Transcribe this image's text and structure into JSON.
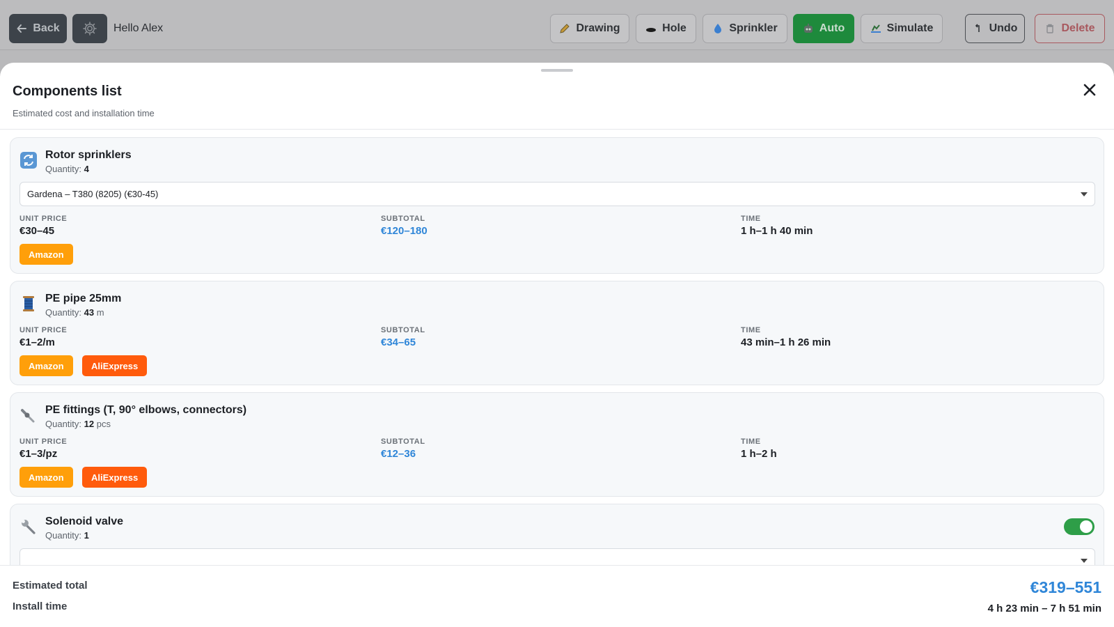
{
  "toolbar": {
    "back_label": "Back",
    "greeting": "Hello Alex",
    "tools": [
      {
        "label": "Drawing",
        "icon": "pencil-icon"
      },
      {
        "label": "Hole",
        "icon": "hole-icon"
      },
      {
        "label": "Sprinkler",
        "icon": "droplet-icon"
      },
      {
        "label": "Auto",
        "icon": "robot-icon",
        "active": true
      },
      {
        "label": "Simulate",
        "icon": "simulate-icon"
      }
    ],
    "undo_label": "Undo",
    "delete_label": "Delete"
  },
  "sheet": {
    "title": "Components list",
    "subtitle": "Estimated cost and installation time"
  },
  "labels": {
    "unit_price": "UNIT PRICE",
    "subtotal": "SUBTOTAL",
    "time": "TIME",
    "quantity": "Quantity:"
  },
  "components": [
    {
      "name": "Rotor sprinklers",
      "icon": "rotate-icon",
      "quantity": "4",
      "unit": "",
      "selected_model": "Gardena – T380 (8205) (€30-45)",
      "unit_price": "€30–45",
      "subtotal": "€120–180",
      "time": "1 h–1 h 40 min",
      "shops": [
        "Amazon"
      ]
    },
    {
      "name": "PE pipe 25mm",
      "icon": "spool-icon",
      "quantity": "43",
      "unit": "m",
      "unit_price": "€1–2/m",
      "subtotal": "€34–65",
      "time": "43 min–1 h 26 min",
      "shops": [
        "Amazon",
        "AliExpress"
      ]
    },
    {
      "name": "PE fittings (T, 90° elbows, connectors)",
      "icon": "fitting-icon",
      "quantity": "12",
      "unit": "pcs",
      "unit_price": "€1–3/pz",
      "subtotal": "€12–36",
      "time": "1 h–2 h",
      "shops": [
        "Amazon",
        "AliExpress"
      ]
    },
    {
      "name": "Solenoid valve",
      "icon": "wrench-icon",
      "quantity": "1",
      "unit": "",
      "enabled": true
    }
  ],
  "footer": {
    "total_label": "Estimated total",
    "total_value": "€319–551",
    "time_label": "Install time",
    "time_value": "4 h 23 min – 7 h 51 min"
  },
  "colors": {
    "accent_blue": "#2f86d8",
    "auto_green": "#1e8a3c",
    "amazon": "#ff9f0a",
    "aliexpress": "#ff5b0c",
    "delete_red": "#a8585e"
  }
}
